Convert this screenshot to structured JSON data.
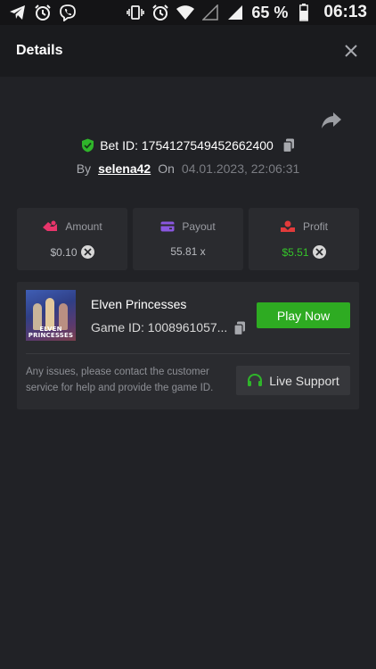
{
  "status_bar": {
    "battery_percent": "65 %",
    "time": "06:13",
    "icons": [
      "telegram-icon",
      "alarm-icon",
      "viber-icon",
      "vibrate-icon",
      "alarm-icon",
      "wifi-icon",
      "signal-icon",
      "signal-icon",
      "battery-icon"
    ]
  },
  "header": {
    "title": "Details",
    "close_icon": "close-icon"
  },
  "share_icon": "share-icon",
  "bet": {
    "label": "Bet ID: 1754127549452662400",
    "by_label": "By",
    "username": "selena42",
    "on_label": "On",
    "datetime": "04.01.2023, 22:06:31"
  },
  "stats": [
    {
      "label": "Amount",
      "value": "$0.10",
      "icon": "amount-icon",
      "has_badge": true
    },
    {
      "label": "Payout",
      "value": "55.81 x",
      "icon": "payout-icon",
      "has_badge": false
    },
    {
      "label": "Profit",
      "value": "$5.51",
      "icon": "profit-icon",
      "has_badge": true
    }
  ],
  "game": {
    "title": "Elven Princesses",
    "id": "Game ID: 1008961057...",
    "thumb_line1": "ELVEN",
    "thumb_line2": "PRINCESSES",
    "play_label": "Play Now",
    "help_text": "Any issues, please contact the customer service for help and provide the game ID.",
    "support_label": "Live Support"
  },
  "colors": {
    "background": "#212226",
    "card": "#2a2b2f",
    "accent_green": "#2eab22",
    "profit_green": "#35c42a",
    "amount_pink": "#e8356b",
    "payout_purple": "#8a57e0",
    "profit_red": "#e23b3b"
  }
}
